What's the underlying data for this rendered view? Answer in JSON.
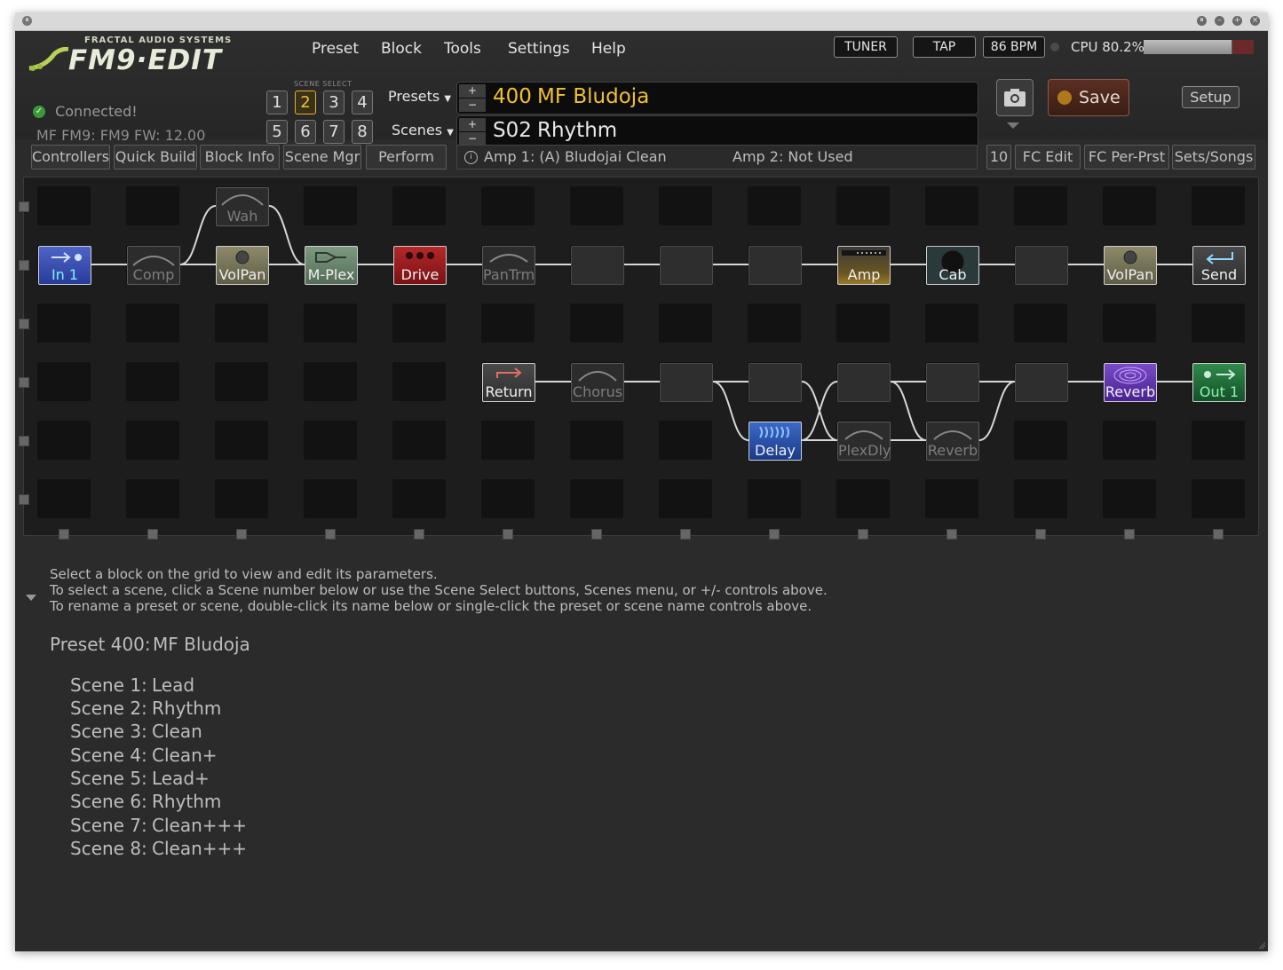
{
  "window": {
    "min_icon": "minimize-icon",
    "max_icon": "maximize-icon",
    "close_icon": "close-icon"
  },
  "logo": {
    "small": "FRACTAL AUDIO SYSTEMS",
    "big": "FM9·EDIT"
  },
  "menu": [
    "Preset",
    "Block",
    "Tools",
    "Settings",
    "Help"
  ],
  "top_right": {
    "tuner": "TUNER",
    "tap": "TAP",
    "bpm": "86 BPM",
    "cpu": "CPU 80.2%",
    "cpu_level": 0.802
  },
  "scene_select": {
    "label": "SCENE SELECT",
    "buttons": [
      "1",
      "2",
      "3",
      "4",
      "5",
      "6",
      "7",
      "8"
    ],
    "active": "2"
  },
  "dropdowns": {
    "presets": "Presets",
    "scenes": "Scenes"
  },
  "preset": {
    "number": "400",
    "name": "MF Bludoja",
    "color": "#f2c12e"
  },
  "scene": {
    "number": "S02",
    "name": "Rhythm"
  },
  "buttons": {
    "save": "Save",
    "setup": "Setup"
  },
  "status": {
    "connected": "Connected!",
    "firmware": "MF FM9: FM9 FW: 12.00"
  },
  "toolbar": {
    "controllers": "Controllers",
    "quick_build": "Quick Build",
    "block_info": "Block Info",
    "scene_mgr": "Scene Mgr",
    "perform": "Perform",
    "amp1": "Amp 1: (A) Bludojai Clean",
    "amp2": "Amp 2: Not Used",
    "count": "10",
    "fc_edit": "FC Edit",
    "fc_per_prst": "FC Per-Prst",
    "sets_songs": "Sets/Songs"
  },
  "grid_blocks": [
    {
      "label": "Wah",
      "state": "bypassed",
      "icon": "wah-icon"
    },
    {
      "label": "In 1",
      "state": "active",
      "icon": "input-icon"
    },
    {
      "label": "Comp",
      "state": "bypassed",
      "icon": "compressor-icon"
    },
    {
      "label": "VolPan",
      "state": "active",
      "icon": "volume-icon"
    },
    {
      "label": "M-Plex",
      "state": "active",
      "icon": "multiplex-icon"
    },
    {
      "label": "Drive",
      "state": "active",
      "icon": "drive-icon"
    },
    {
      "label": "PanTrm",
      "state": "bypassed",
      "icon": "pantrem-icon"
    },
    {
      "label": "Amp",
      "state": "active",
      "icon": "amp-icon"
    },
    {
      "label": "Cab",
      "state": "active",
      "icon": "cab-icon"
    },
    {
      "label": "VolPan",
      "state": "active",
      "icon": "volume-icon"
    },
    {
      "label": "Send",
      "state": "active",
      "icon": "send-icon"
    },
    {
      "label": "Return",
      "state": "active",
      "icon": "return-icon"
    },
    {
      "label": "Chorus",
      "state": "bypassed",
      "icon": "chorus-icon"
    },
    {
      "label": "Reverb",
      "state": "active",
      "icon": "reverb-icon"
    },
    {
      "label": "Out 1",
      "state": "active",
      "icon": "output-icon"
    },
    {
      "label": "Delay",
      "state": "active",
      "icon": "delay-icon"
    },
    {
      "label": "PlexDly",
      "state": "bypassed",
      "icon": "plexdelay-icon"
    },
    {
      "label": "Reverb",
      "state": "bypassed",
      "icon": "reverb-icon"
    }
  ],
  "info": {
    "line1": "Select a block on the grid to view and edit its parameters.",
    "line2": "To select a scene, click a Scene number below or use the Scene Select buttons, Scenes menu, or +/- controls above.",
    "line3": "To rename a preset or scene, double-click its name below or single-click the preset or scene name controls above.",
    "preset_label": "Preset 400:",
    "preset_name": "MF Bludoja",
    "scenes": [
      {
        "label": "Scene 1:",
        "name": "Lead"
      },
      {
        "label": "Scene 2:",
        "name": "Rhythm"
      },
      {
        "label": "Scene 3:",
        "name": "Clean"
      },
      {
        "label": "Scene 4:",
        "name": "Clean+"
      },
      {
        "label": "Scene 5:",
        "name": "Lead+"
      },
      {
        "label": "Scene 6:",
        "name": "Rhythm"
      },
      {
        "label": "Scene 7:",
        "name": "Clean+++"
      },
      {
        "label": "Scene 8:",
        "name": "Clean+++"
      }
    ]
  }
}
